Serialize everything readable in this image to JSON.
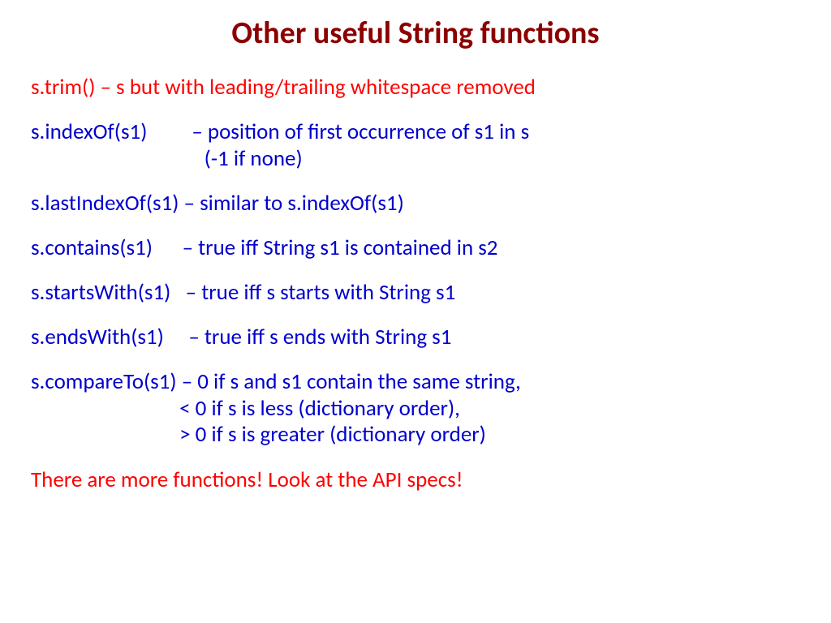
{
  "title": "Other useful String functions",
  "lines": {
    "trim": "s.trim() – s but with leading/trailing whitespace removed",
    "indexOf": "s.indexOf(s1)         – position of first occurrence of s1 in s\n                                   (-1 if none)",
    "lastIndexOf": "s.lastIndexOf(s1) – similar to s.indexOf(s1)",
    "contains": "s.contains(s1)      – true iff String s1 is contained in s2",
    "startsWith": "s.startsWith(s1)   – true iff s starts with String s1",
    "endsWith": "s.endsWith(s1)     – true iff s ends with String s1",
    "compareTo": "s.compareTo(s1) – 0 if s and s1 contain the same string,\n                              < 0 if s is less (dictionary order),\n                              > 0 if s is greater (dictionary order)"
  },
  "footer": "There are more functions! Look at the API specs!"
}
